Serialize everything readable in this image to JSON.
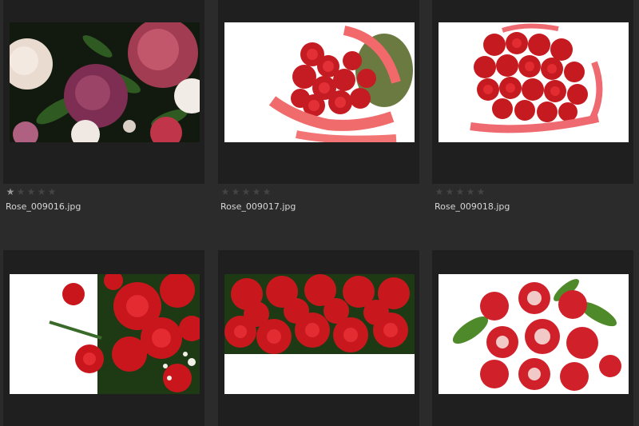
{
  "gallery": {
    "items": [
      {
        "filename": "Rose_009016.jpg",
        "rating": 1,
        "max_rating": 5,
        "thumbnail": "mixed-roses-pink-white-dark"
      },
      {
        "filename": "Rose_009017.jpg",
        "rating": 0,
        "max_rating": 5,
        "thumbnail": "red-roses-pink-ribbon-white-bg"
      },
      {
        "filename": "Rose_009018.jpg",
        "rating": 0,
        "max_rating": 5,
        "thumbnail": "red-rose-bouquet-ribbon-white-bg"
      },
      {
        "filename": "",
        "rating": 0,
        "max_rating": 5,
        "thumbnail": "red-roses-white-left"
      },
      {
        "filename": "",
        "rating": 0,
        "max_rating": 5,
        "thumbnail": "red-roses-row-white-bottom"
      },
      {
        "filename": "",
        "rating": 0,
        "max_rating": 5,
        "thumbnail": "red-white-roses-bouquet"
      }
    ]
  },
  "colors": {
    "background": "#2b2b2b",
    "card": "#1f1f1f",
    "star_filled": "#9a9a9a",
    "star_empty": "#444444",
    "text": "#d6d6d6"
  }
}
